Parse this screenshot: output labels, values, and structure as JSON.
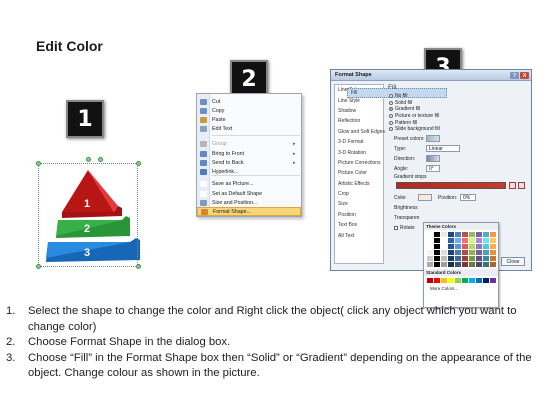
{
  "title": "Edit Color",
  "step_numbers": [
    "1",
    "2",
    "3"
  ],
  "pyramid": {
    "labels": [
      "1",
      "2",
      "3"
    ],
    "colors": [
      "#d42020",
      "#2c9e3a",
      "#1c7bd1"
    ]
  },
  "context_menu": {
    "items": [
      {
        "label": "Cut",
        "underline": "t",
        "color": "#6b8fc6"
      },
      {
        "label": "Copy",
        "color": "#6b8fc6"
      },
      {
        "label": "Paste",
        "color": "#c99a3b"
      },
      {
        "label": "Edit Text",
        "color": "#8aa0bd"
      },
      {
        "label": "Group",
        "disabled": true,
        "arrow": "▸",
        "color": "#b5b5b5"
      },
      {
        "label": "Bring to Front",
        "arrow": "▸",
        "color": "#5d8ac7"
      },
      {
        "label": "Send to Back",
        "arrow": "▸",
        "color": "#5d8ac7"
      },
      {
        "label": "Hyperlink...",
        "color": "#4f7bc0"
      },
      {
        "label": "Save as Picture...",
        "color": "#ffffff"
      },
      {
        "label": "Set as Default Shape",
        "color": "#ffffff"
      },
      {
        "label": "Size and Position...",
        "color": "#7a9cc9"
      },
      {
        "label": "Format Shape...",
        "highlight": true,
        "color": "#d8862c"
      }
    ]
  },
  "dialog": {
    "title": "Format Shape",
    "help": "?",
    "close": "X",
    "categories": [
      "Fill",
      "Line Color",
      "Line Style",
      "Shadow",
      "Reflection",
      "Glow and Soft Edges",
      "3-D Format",
      "3-D Rotation",
      "Picture Corrections",
      "Picture Color",
      "Artistic Effects",
      "Crop",
      "Size",
      "Position",
      "Text Box",
      "Alt Text"
    ],
    "fill": {
      "heading": "Fill",
      "options": [
        "No fill",
        "Solid fill",
        "Gradient fill",
        "Picture or texture fill",
        "Pattern fill",
        "Slide background fill"
      ],
      "selected": 2,
      "preset_label": "Preset colors:",
      "type_label": "Type:",
      "type_value": "Linear",
      "direction_label": "Direction:",
      "angle_label": "Angle:",
      "angle_value": "0°",
      "stops_label": "Gradient stops",
      "color_label": "Color",
      "position_label": "Position:",
      "position_value": "0%",
      "brightness_label": "Brightness",
      "transparency_label": "Transparen",
      "rotate_label": "Rotate"
    },
    "palette": {
      "theme_label": "Theme Colors",
      "standard_label": "Standard Colors",
      "more_label": "More Colors...",
      "theme": [
        "#ffffff",
        "#000000",
        "#eeece1",
        "#1f497d",
        "#4f81bd",
        "#c0504d",
        "#9bbb59",
        "#8064a2",
        "#4bacc6",
        "#f79646"
      ],
      "standard": [
        "#c00000",
        "#ff0000",
        "#ffc000",
        "#ffff00",
        "#92d050",
        "#00b050",
        "#00b0f0",
        "#0070c0",
        "#002060",
        "#7030a0"
      ]
    },
    "close_button": "Close"
  },
  "instructions": [
    {
      "num": "1.",
      "text": "Select the shape to change the color and Right click the object( click any object which you want to change color)"
    },
    {
      "num": "2.",
      "text": "Choose Format Shape in the dialog box."
    },
    {
      "num": "3.",
      "text": "Choose “Fill” in the Format Shape box then “Solid” or “Gradient” depending on the appearance of the object. Change colour as shown in the picture."
    }
  ]
}
